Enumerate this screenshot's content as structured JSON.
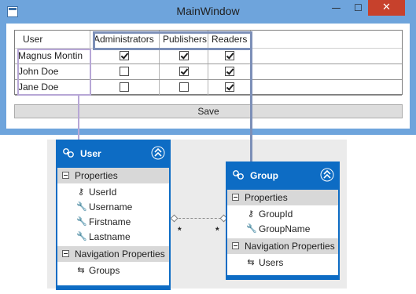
{
  "window": {
    "title": "MainWindow",
    "minimize_glyph": "—",
    "maximize_glyph": "☐",
    "close_glyph": "✕"
  },
  "grid": {
    "columns": [
      "User",
      "Administrators",
      "Publishers",
      "Readers"
    ],
    "rows": [
      {
        "user": "Magnus Montin",
        "administrators": true,
        "publishers": true,
        "readers": true
      },
      {
        "user": "John Doe",
        "administrators": false,
        "publishers": true,
        "readers": true
      },
      {
        "user": "Jane Doe",
        "administrators": false,
        "publishers": false,
        "readers": true
      }
    ]
  },
  "save_label": "Save",
  "entities": {
    "user": {
      "name": "User",
      "properties_label": "Properties",
      "properties": [
        "UserId",
        "Username",
        "Firstname",
        "Lastname"
      ],
      "navigation_label": "Navigation Properties",
      "navigation": [
        "Groups"
      ]
    },
    "group": {
      "name": "Group",
      "properties_label": "Properties",
      "properties": [
        "GroupId",
        "GroupName"
      ],
      "navigation_label": "Navigation Properties",
      "navigation": [
        "Users"
      ]
    }
  },
  "association": {
    "left_multiplicity": "*",
    "right_multiplicity": "*"
  },
  "colors": {
    "window_border": "#6ea4dc",
    "close_button": "#c7412c",
    "entity_header": "#0d6cc4",
    "highlight_roles": "#7c8fb7",
    "highlight_users": "#b7a7d6"
  },
  "icons": {
    "entity": "entity-icon",
    "collapse": "double-chevron-up-icon",
    "key_property": "key-icon",
    "scalar_property": "wrench-icon",
    "navigation_property": "navigation-icon"
  }
}
